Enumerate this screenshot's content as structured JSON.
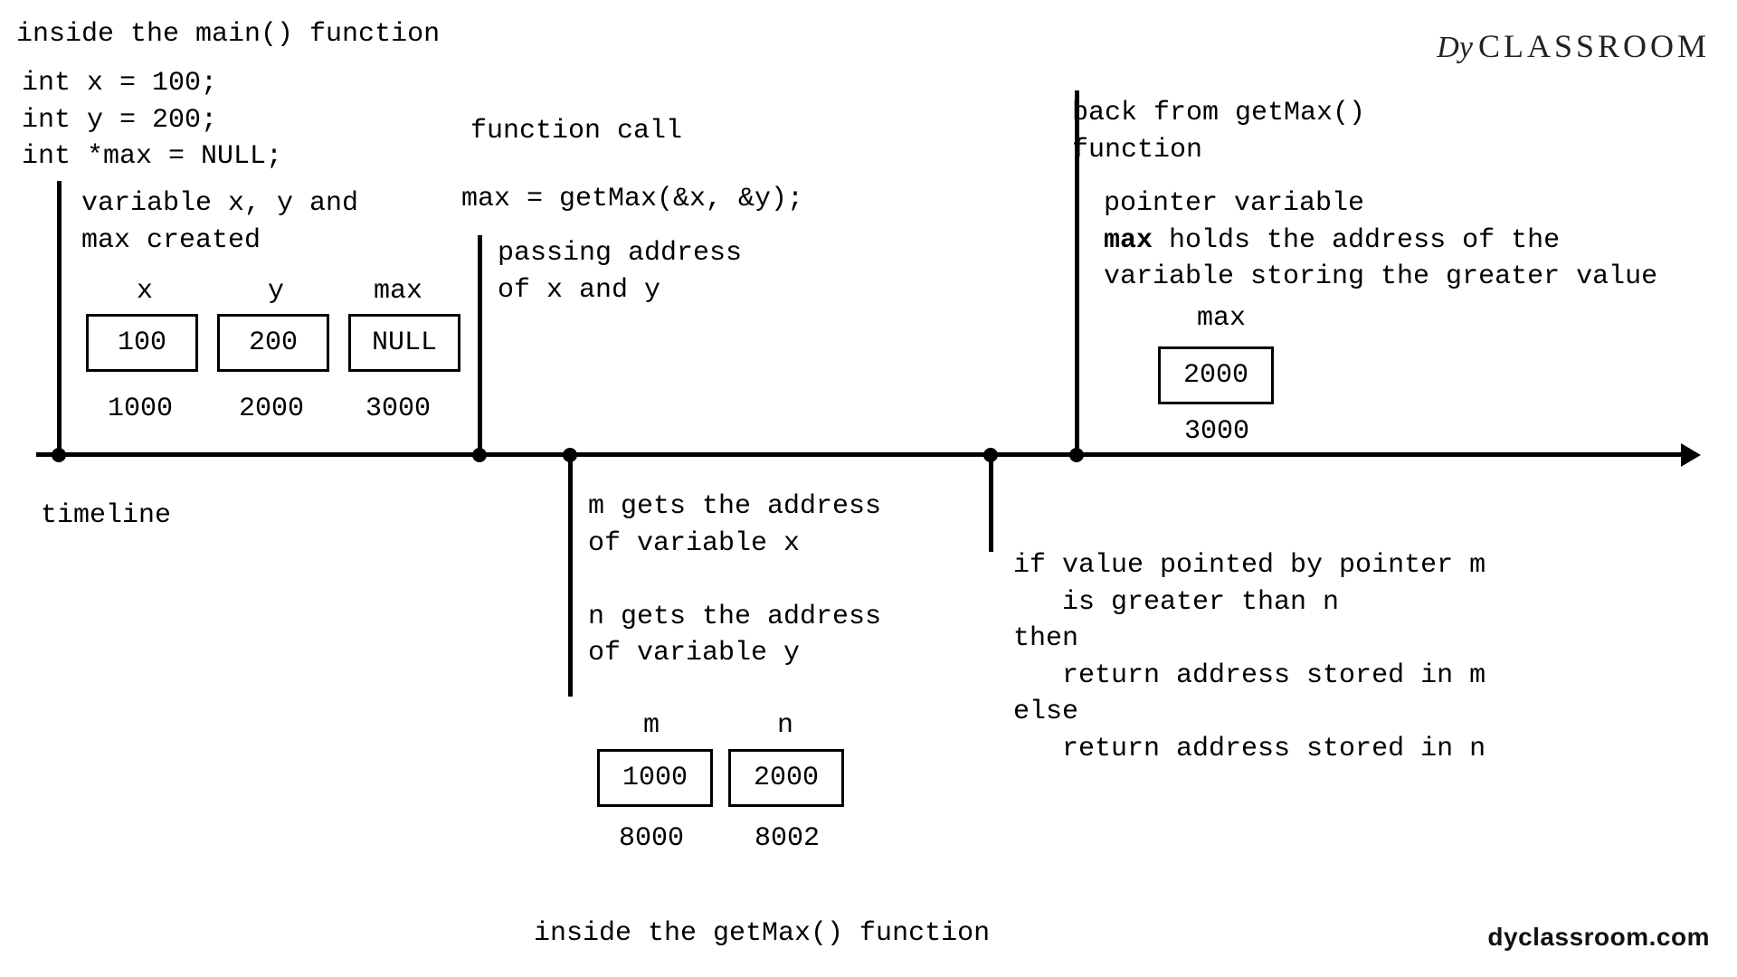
{
  "header": {
    "title_main": "inside the main() function",
    "logo_text": "CLASSROOM",
    "logo_prefix": "Dy"
  },
  "code_decls": "int x = 100;\nint y = 200;\nint *max = NULL;",
  "section1": {
    "caption": "variable x, y and\nmax created",
    "vars": [
      {
        "name": "x",
        "value": "100",
        "addr": "1000"
      },
      {
        "name": "y",
        "value": "200",
        "addr": "2000"
      },
      {
        "name": "max",
        "value": "NULL",
        "addr": "3000"
      }
    ]
  },
  "section2": {
    "title": "function call",
    "call_line": "max = getMax(&x, &y);",
    "caption": "passing address\nof x and y"
  },
  "section3": {
    "title": "back from getMax()\nfunction",
    "caption_pre": "pointer variable\n",
    "caption_bold": "max",
    "caption_post": " holds the address of the\nvariable storing the greater value",
    "var": {
      "name": "max",
      "value": "2000",
      "addr": "3000"
    }
  },
  "below1": {
    "caption": "m gets the address\nof variable x\n\nn gets the address\nof variable y",
    "vars": [
      {
        "name": "m",
        "value": "1000",
        "addr": "8000"
      },
      {
        "name": "n",
        "value": "2000",
        "addr": "8002"
      }
    ]
  },
  "below2": {
    "text": "if value pointed by pointer m\n   is greater than n\nthen\n   return address stored in m\nelse\n   return address stored in n"
  },
  "timeline_label": "timeline",
  "footer_title": "inside the getMax() function",
  "footer_brand": "dyclassroom.com"
}
